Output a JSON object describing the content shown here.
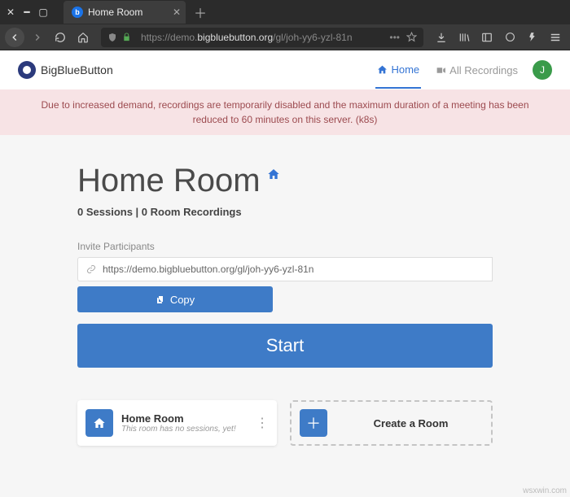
{
  "browser": {
    "tab_title": "Home Room",
    "url_full": "https://demo.bigbluebutton.org/gl/joh-yy6-yzl-81n",
    "url_prefix": "https://demo.",
    "url_host": "bigbluebutton.org",
    "url_path": "/gl/joh-yy6-yzl-81n"
  },
  "nav": {
    "brand": "BigBlueButton",
    "home": "Home",
    "recordings": "All Recordings",
    "avatar_letter": "J"
  },
  "alert": "Due to increased demand, recordings are temporarily disabled and the maximum duration of a meeting has been reduced to 60 minutes on this server. (k8s)",
  "room": {
    "title": "Home Room",
    "subtitle": "0 Sessions | 0 Room Recordings",
    "invite_label": "Invite Participants",
    "invite_url": "https://demo.bigbluebutton.org/gl/joh-yy6-yzl-81n",
    "copy_label": "Copy",
    "start_label": "Start"
  },
  "rooms": {
    "card_title": "Home Room",
    "card_sub": "This room has no sessions, yet!",
    "create_label": "Create a Room"
  },
  "watermark": "wsxwin.com"
}
